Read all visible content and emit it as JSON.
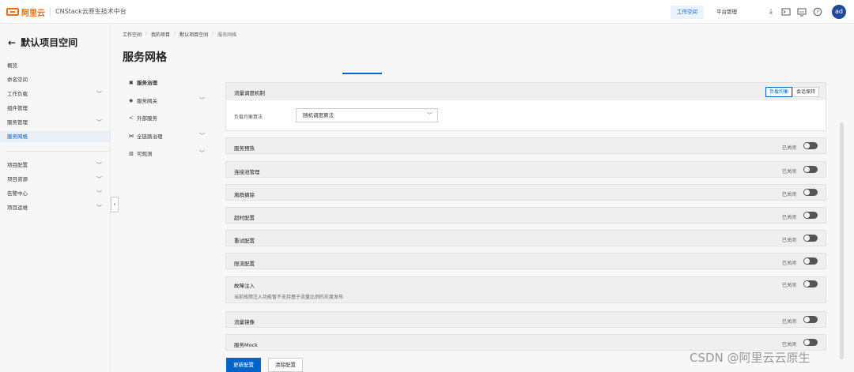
{
  "topbar": {
    "logo_text": "阿里云",
    "app_title": "CNStack云原生技术中台",
    "tabs": [
      "工作空间",
      "平台管理"
    ],
    "icons": [
      "download-icon",
      "terminal-icon",
      "monitor-icon",
      "help-icon"
    ],
    "avatar": "ad"
  },
  "sidebar": {
    "title": "默认项目空间",
    "items": [
      {
        "label": "概览",
        "expandable": false
      },
      {
        "label": "命名空间",
        "expandable": false
      },
      {
        "label": "工作负载",
        "expandable": true
      },
      {
        "label": "组件管理",
        "expandable": false
      },
      {
        "label": "服务管理",
        "expandable": true
      },
      {
        "label": "服务网格",
        "expandable": false,
        "active": true
      }
    ],
    "items2": [
      {
        "label": "项目配置",
        "expandable": true
      },
      {
        "label": "项目资源",
        "expandable": true
      },
      {
        "label": "告警中心",
        "expandable": true
      },
      {
        "label": "项目运维",
        "expandable": true
      }
    ]
  },
  "breadcrumb": [
    "工作空间",
    "我的项目",
    "默认项目空间",
    "服务网格"
  ],
  "page_title": "服务网格",
  "subnav": [
    {
      "label": "服务治理",
      "icon": "monitor-icon",
      "expandable": false,
      "active": true
    },
    {
      "label": "服务网关",
      "icon": "shield-icon",
      "expandable": true
    },
    {
      "label": "外部服务",
      "icon": "share-icon",
      "expandable": false
    },
    {
      "label": "全链路治理",
      "icon": "nodes-icon",
      "expandable": true
    },
    {
      "label": "可观测",
      "icon": "bar-chart-icon",
      "expandable": true
    }
  ],
  "traffic": {
    "title": "流量调度机制",
    "modes": [
      "负载均衡",
      "会话保持"
    ],
    "active_mode": "负载均衡",
    "field_label": "负载均衡算法",
    "select_value": "随机调度算法"
  },
  "panels": [
    {
      "title": "服务预热",
      "status": "已关闭",
      "enabled": false
    },
    {
      "title": "连接池管理",
      "status": "已关闭",
      "enabled": false
    },
    {
      "title": "离群摘除",
      "status": "已关闭",
      "enabled": false
    },
    {
      "title": "超时配置",
      "status": "已关闭",
      "enabled": false
    },
    {
      "title": "重试配置",
      "status": "已关闭",
      "enabled": false
    },
    {
      "title": "限流配置",
      "status": "已关闭",
      "enabled": false
    },
    {
      "title": "故障注入",
      "status": "已关闭",
      "enabled": false,
      "note": "当前故障注入功能暂不支持基于流量比例的灰度发布"
    },
    {
      "title": "流量镜像",
      "status": "已关闭",
      "enabled": false
    },
    {
      "title": "服务Mock",
      "status": "已关闭",
      "enabled": false
    }
  ],
  "buttons": {
    "update": "更新配置",
    "clear": "清除配置"
  },
  "watermark": "CSDN @阿里云云原生",
  "colors": {
    "accent": "#0064c8",
    "brand": "#ff6a00"
  }
}
